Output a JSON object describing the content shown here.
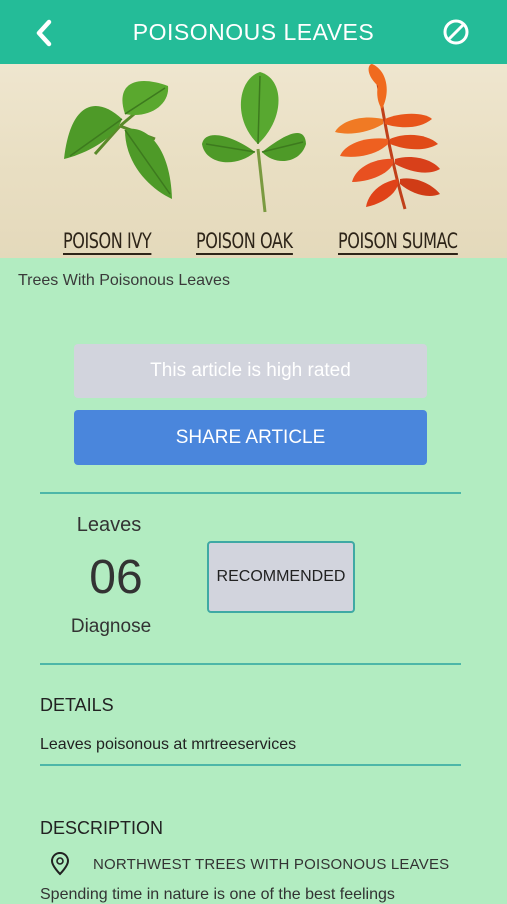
{
  "header": {
    "title": "POISONOUS LEAVES",
    "back_icon": "chevron-left-icon",
    "action_icon": "block-icon",
    "bar_color": "#24bc98"
  },
  "hero": {
    "labels": [
      "POISON IVY",
      "POISON OAK",
      "POISON SUMAC"
    ]
  },
  "caption": "Trees With Poisonous Leaves",
  "buttons": {
    "rated_label": "This article is high rated",
    "share_label": "SHARE ARTICLE",
    "share_color": "#4a86dc"
  },
  "stats": {
    "top_label": "Leaves",
    "value": "06",
    "bottom_label": "Diagnose",
    "recommended_label": "RECOMMENDED"
  },
  "details": {
    "heading": "DETAILS",
    "text": "Leaves poisonous at mrtreeservices"
  },
  "description": {
    "heading": "DESCRIPTION",
    "location_icon": "map-pin-icon",
    "location_text": "NORTHWEST TREES WITH POISONOUS LEAVES",
    "body": "Spending time in nature is one of the best feelings"
  }
}
